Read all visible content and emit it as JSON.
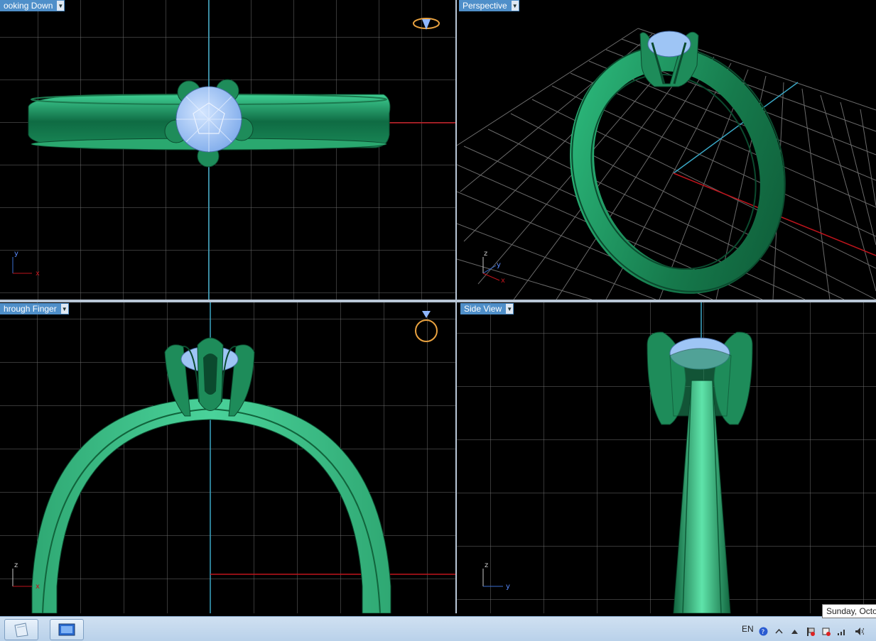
{
  "viewports": {
    "top": {
      "label": "ooking Down"
    },
    "perspective": {
      "label": "Perspective"
    },
    "front": {
      "label": "hrough Finger"
    },
    "side": {
      "label": "Side View"
    }
  },
  "axes": {
    "top": {
      "vertical": "y",
      "horizontal": "x"
    },
    "perspective": {
      "up": "z",
      "depth": "y",
      "right": "x"
    },
    "front": {
      "vertical": "z",
      "horizontal": "x"
    },
    "side": {
      "vertical": "z",
      "horizontal": "y"
    }
  },
  "taskbar": {
    "language": "EN",
    "clock_tooltip": "Sunday, Octo"
  },
  "colors": {
    "ring_metal": "#22a070",
    "stone": "#9ec5f5",
    "label_bg": "#4f8fc9",
    "axis_red": "#c0141c",
    "axis_cyan": "#3aa6c4",
    "taskbar": "#c4d8ee"
  },
  "icons": [
    "viewport-dropdown-icon",
    "view-orientation-icon",
    "start-orb-icon",
    "desktop-icon",
    "help-icon",
    "network-icon",
    "volume-icon",
    "flag-icon"
  ]
}
